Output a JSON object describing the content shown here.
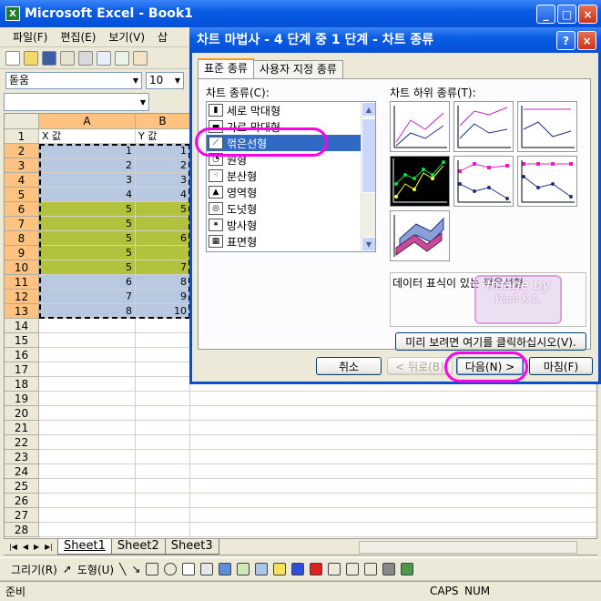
{
  "app": {
    "title": "Microsoft Excel - Book1",
    "icon_label": "X"
  },
  "window_buttons": {
    "minimize": "_",
    "maximize": "□",
    "close": "×"
  },
  "menu": [
    "파일(F)",
    "편집(E)",
    "보기(V)",
    "삽"
  ],
  "format": {
    "font": "돋움",
    "size": "10"
  },
  "columns": [
    "A",
    "B"
  ],
  "rows": [
    "1",
    "2",
    "3",
    "4",
    "5",
    "6",
    "7",
    "8",
    "9",
    "10",
    "11",
    "12",
    "13",
    "14",
    "15",
    "16",
    "17",
    "18",
    "19",
    "20",
    "21",
    "22",
    "23",
    "24",
    "25",
    "26",
    "27",
    "28"
  ],
  "headers": {
    "a": "X 값",
    "b": "Y 값"
  },
  "table": [
    {
      "x": "1",
      "y": "1",
      "fill": "blue"
    },
    {
      "x": "2",
      "y": "2",
      "fill": "blue"
    },
    {
      "x": "3",
      "y": "3",
      "fill": "blue"
    },
    {
      "x": "4",
      "y": "4",
      "fill": "blue"
    },
    {
      "x": "5",
      "y": "5",
      "fill": "green"
    },
    {
      "x": "5",
      "y": "",
      "fill": "green"
    },
    {
      "x": "5",
      "y": "6",
      "fill": "green"
    },
    {
      "x": "5",
      "y": "",
      "fill": "green"
    },
    {
      "x": "5",
      "y": "7",
      "fill": "green"
    },
    {
      "x": "6",
      "y": "8",
      "fill": "blue"
    },
    {
      "x": "7",
      "y": "9",
      "fill": "blue"
    },
    {
      "x": "8",
      "y": "10",
      "fill": "blue"
    }
  ],
  "sheet_tabs": [
    "Sheet1",
    "Sheet2",
    "Sheet3"
  ],
  "draw_toolbar": {
    "draw": "그리기(R)",
    "shapes": "도형(U)"
  },
  "status": {
    "ready": "준비",
    "caps": "CAPS",
    "num": "NUM"
  },
  "dialog": {
    "title": "차트 마법사 - 4 단계 중 1 단계 - 차트 종류",
    "help": "?",
    "close": "×",
    "tabs": [
      "표준 종류",
      "사용자 지정 종류"
    ],
    "chart_type_label": "차트 종류(C):",
    "chart_types": [
      {
        "label": "세로 막대형",
        "icon": "column-chart-icon"
      },
      {
        "label": "가로 막대형",
        "icon": "bar-chart-icon"
      },
      {
        "label": "꺾은선형",
        "icon": "line-chart-icon"
      },
      {
        "label": "원형",
        "icon": "pie-chart-icon"
      },
      {
        "label": "분산형",
        "icon": "scatter-chart-icon"
      },
      {
        "label": "영역형",
        "icon": "area-chart-icon"
      },
      {
        "label": "도넛형",
        "icon": "doughnut-chart-icon"
      },
      {
        "label": "방사형",
        "icon": "radar-chart-icon"
      },
      {
        "label": "표면형",
        "icon": "surface-chart-icon"
      }
    ],
    "selected_index": 2,
    "subtype_label": "차트 하위 종류(T):",
    "description": "데이터 표식이 있는 꺾은선형",
    "preview_button": "미리 보려면 여기를 클릭하십시오(V).",
    "buttons": {
      "cancel": "취소",
      "back": "< 뒤로(B)",
      "next": "다음(N) >",
      "finish": "마침(F)"
    }
  },
  "watermark": {
    "line1": "Image by",
    "line2": "Yaan K.L."
  }
}
